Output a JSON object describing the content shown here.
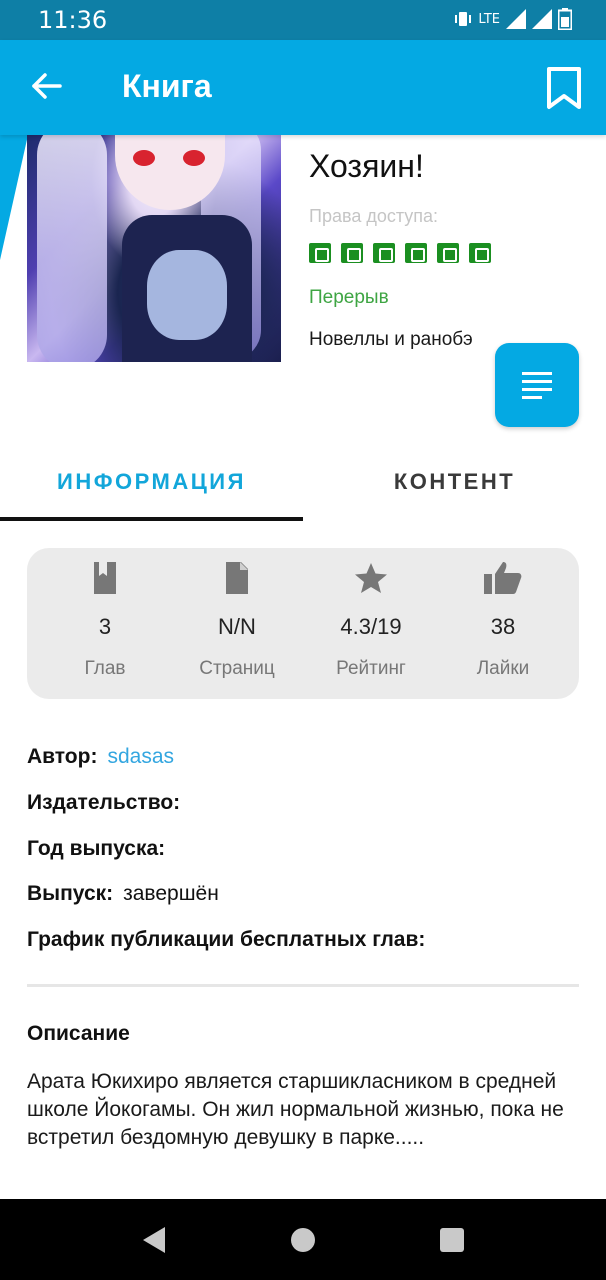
{
  "status_bar": {
    "time": "11:36",
    "network": "LTE"
  },
  "app_bar": {
    "title": "Книга",
    "back_icon": "arrow-left-icon",
    "bookmark_icon": "bookmark-icon"
  },
  "book": {
    "title": "Хозяин!",
    "rights_label": "Права доступа:",
    "rights_icons": [
      "login-icon",
      "eye-icon",
      "download-icon",
      "plus-minus-icon",
      "comment-icon",
      "forward-icon"
    ],
    "status": "Перерыв",
    "genre": "Новеллы и ранобэ"
  },
  "tabs": [
    {
      "label": "ИНФОРМАЦИЯ",
      "active": true
    },
    {
      "label": "КОНТЕНТ",
      "active": false
    }
  ],
  "stats": [
    {
      "icon": "bookmark-book-icon",
      "value": "3",
      "label": "Глав"
    },
    {
      "icon": "page-icon",
      "value": "N/N",
      "label": "Страниц"
    },
    {
      "icon": "star-icon",
      "value": "4.3/19",
      "label": "Рейтинг"
    },
    {
      "icon": "thumb-up-icon",
      "value": "38",
      "label": "Лайки"
    }
  ],
  "info": {
    "author_label": "Автор:",
    "author_value": "sdasas",
    "publisher_label": "Издательство:",
    "year_label": "Год выпуска:",
    "release_label": "Выпуск:",
    "release_value": "завершён",
    "schedule_label": "График публикации бесплатных глав:"
  },
  "description": {
    "title": "Описание",
    "text": "Арата Юкихиро является старшикласником в средней школе Йокогамы. Он жил нормальной жизнью, пока не встретил бездомную девушку в парке....."
  },
  "colors": {
    "primary": "#04a9e3",
    "status_bar": "#0e7fa6",
    "status_green": "#3ea543",
    "link": "#33a6e0"
  }
}
